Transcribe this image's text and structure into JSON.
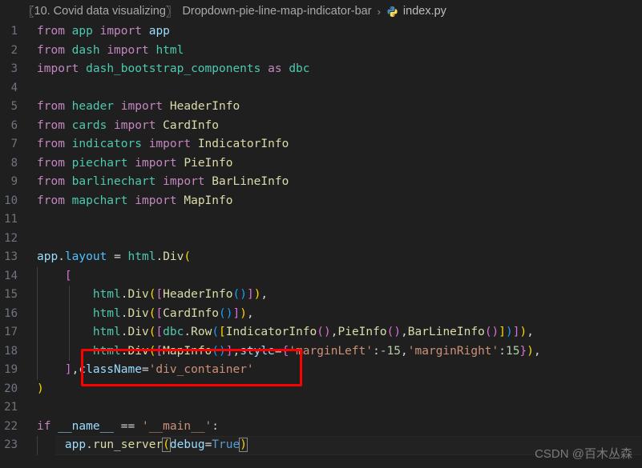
{
  "breadcrumb": {
    "project_open": "〖",
    "project": "10. Covid data visualizing",
    "project_close": "〗",
    "folder": "Dropdown-pie-line-map-indicator-bar",
    "separator": "›",
    "file": "index.py",
    "file_icon": "python-icon"
  },
  "editor": {
    "language": "python",
    "active_line": 23,
    "lines": [
      {
        "n": "1",
        "text": "from app import app"
      },
      {
        "n": "2",
        "text": "from dash import html"
      },
      {
        "n": "3",
        "text": "import dash_bootstrap_components as dbc"
      },
      {
        "n": "4",
        "text": ""
      },
      {
        "n": "5",
        "text": "from header import HeaderInfo"
      },
      {
        "n": "6",
        "text": "from cards import CardInfo"
      },
      {
        "n": "7",
        "text": "from indicators import IndicatorInfo"
      },
      {
        "n": "8",
        "text": "from piechart import PieInfo"
      },
      {
        "n": "9",
        "text": "from barlinechart import BarLineInfo"
      },
      {
        "n": "10",
        "text": "from mapchart import MapInfo"
      },
      {
        "n": "11",
        "text": ""
      },
      {
        "n": "12",
        "text": ""
      },
      {
        "n": "13",
        "text": "app.layout = html.Div("
      },
      {
        "n": "14",
        "text": "    ["
      },
      {
        "n": "15",
        "text": "        html.Div([HeaderInfo()]),"
      },
      {
        "n": "16",
        "text": "        html.Div([CardInfo()]),"
      },
      {
        "n": "17",
        "text": "        html.Div([dbc.Row([IndicatorInfo(),PieInfo(),BarLineInfo()])]),"
      },
      {
        "n": "18",
        "text": "        html.Div([MapInfo()],style={'marginLeft':-15,'marginRight':15}),"
      },
      {
        "n": "19",
        "text": "    ],className='div_container'"
      },
      {
        "n": "20",
        "text": ")"
      },
      {
        "n": "21",
        "text": ""
      },
      {
        "n": "22",
        "text": "if __name__ == '__main__':"
      },
      {
        "n": "23",
        "text": "    app.run_server(debug=True)"
      }
    ]
  },
  "annotation": {
    "shape": "rectangle",
    "color": "#ff0000",
    "highlights_line": "19"
  },
  "watermark": {
    "text": "CSDN @百木丛森"
  },
  "colors": {
    "background": "#1f1f1f",
    "line_number": "#6e7681",
    "keyword": "#c586c0",
    "module": "#4ec9b0",
    "class": "#dcdcaa",
    "variable": "#9cdcfe",
    "string": "#ce9178",
    "number": "#b5cea8",
    "constant": "#569cd6",
    "bracket1": "#ffd700",
    "bracket2": "#da70d6",
    "bracket3": "#179fff",
    "annotation": "#ff0000"
  }
}
